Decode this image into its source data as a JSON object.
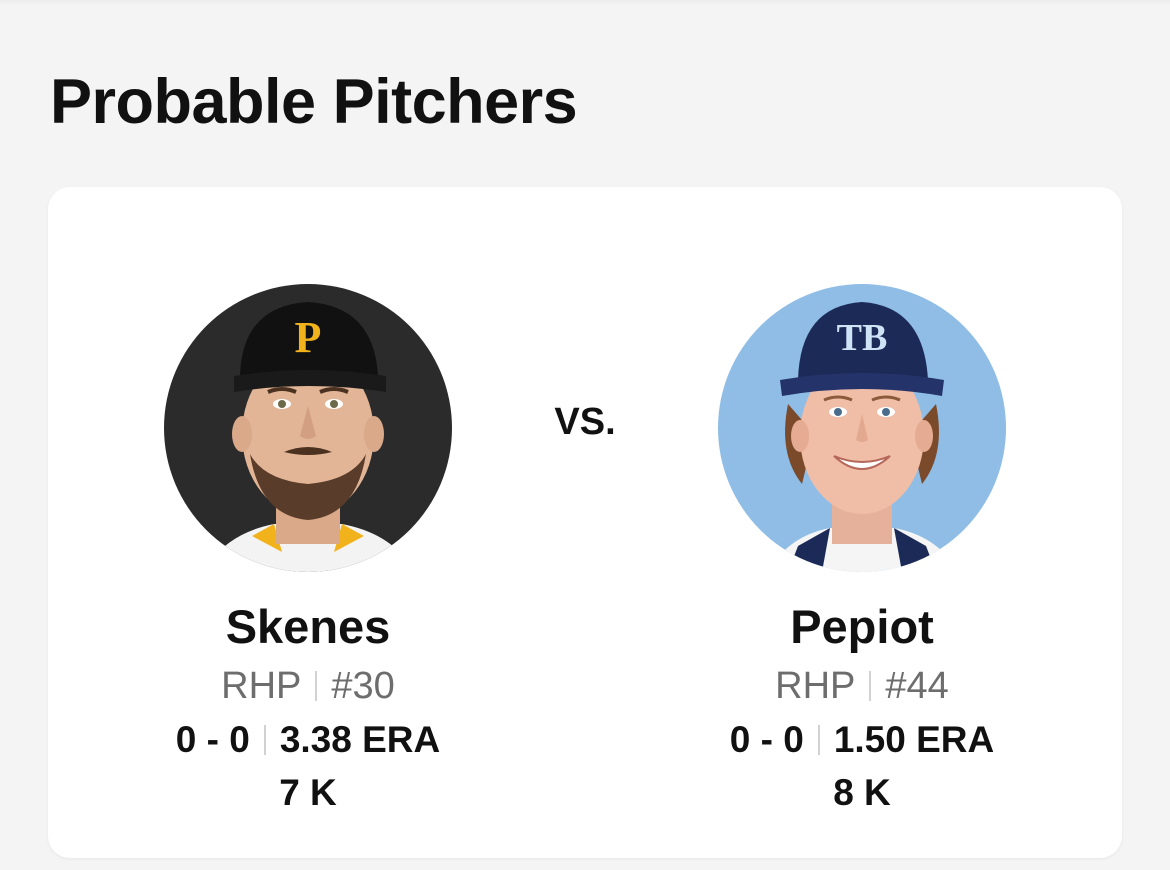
{
  "section": {
    "title": "Probable Pitchers"
  },
  "vs_label": "VS.",
  "pitchers": [
    {
      "name": "Skenes",
      "position": "RHP",
      "number": "#30",
      "record": "0 - 0",
      "era": "3.38 ERA",
      "strikeouts": "7 K",
      "avatar_bg": "#2b2b2b",
      "cap_color": "#111111",
      "cap_logo_color": "#f2b21c",
      "team_logo": "P"
    },
    {
      "name": "Pepiot",
      "position": "RHP",
      "number": "#44",
      "record": "0 - 0",
      "era": "1.50 ERA",
      "strikeouts": "8 K",
      "avatar_bg": "#8fbde6",
      "cap_color": "#1c2a57",
      "cap_logo_color": "#cfe3f7",
      "team_logo": "TB"
    }
  ]
}
